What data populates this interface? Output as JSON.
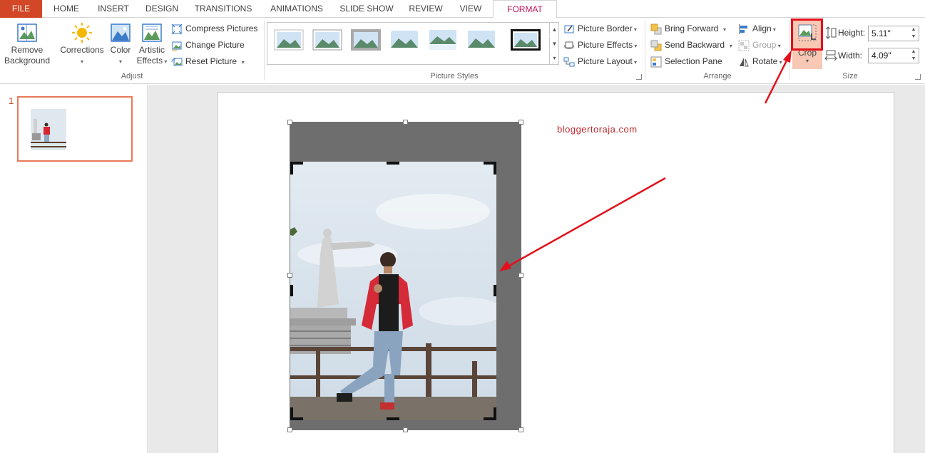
{
  "tabs": {
    "file": "FILE",
    "home": "HOME",
    "insert": "INSERT",
    "design": "DESIGN",
    "transitions": "TRANSITIONS",
    "animations": "ANIMATIONS",
    "slide_show": "SLIDE SHOW",
    "review": "REVIEW",
    "view": "VIEW",
    "format": "FORMAT"
  },
  "ribbon": {
    "adjust": {
      "label": "Adjust",
      "remove_background_1": "Remove",
      "remove_background_2": "Background",
      "corrections": "Corrections",
      "color": "Color",
      "artistic_effects_1": "Artistic",
      "artistic_effects_2": "Effects",
      "compress_pictures": "Compress Pictures",
      "change_picture": "Change Picture",
      "reset_picture": "Reset Picture"
    },
    "picture_styles": {
      "label": "Picture Styles",
      "picture_border": "Picture Border",
      "picture_effects": "Picture Effects",
      "picture_layout": "Picture Layout"
    },
    "arrange": {
      "label": "Arrange",
      "bring_forward": "Bring Forward",
      "send_backward": "Send Backward",
      "selection_pane": "Selection Pane",
      "align": "Align",
      "group": "Group",
      "rotate": "Rotate"
    },
    "size": {
      "label": "Size",
      "crop": "Crop",
      "height_label": "Height:",
      "height_value": "5.11\"",
      "width_label": "Width:",
      "width_value": "4.09\""
    }
  },
  "thumbnails": {
    "slide_number": "1"
  },
  "slide": {
    "watermark": "bloggertoraja.com"
  },
  "colors": {
    "file_tab": "#d24726",
    "active_tab_text": "#c1185b",
    "highlight_box": "#e3101a",
    "arrow": "#e3101a",
    "crop_active_bg": "#f8c8b4"
  }
}
